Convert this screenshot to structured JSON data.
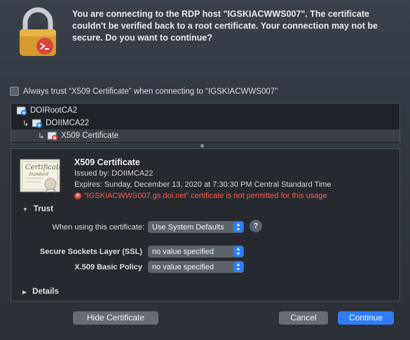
{
  "message": "You are connecting to the RDP host \"IGSKIACWWS007\". The certificate couldn't be verified back to a root certificate. Your connection may not be secure. Do you want to continue?",
  "always_trust": {
    "label": "Always trust “X509 Certificate” when connecting to “IGSKIACWWS007”",
    "checked": false
  },
  "tree": [
    {
      "label": "DOIRootCA2",
      "indent": 0,
      "icon": "certificate-icon"
    },
    {
      "label": "DOIIMCA22",
      "indent": 1,
      "icon": "certificate-icon"
    },
    {
      "label": "X509 Certificate",
      "indent": 2,
      "icon": "certificate-invalid-icon",
      "selected": true
    }
  ],
  "certificate": {
    "title": "X509 Certificate",
    "issued_by": "Issued by: DOIIMCA22",
    "expires": "Expires: Sunday, December 13, 2020 at 7:30:30 PM Central Standard Time",
    "warning": "“IGSKIACWWS007.gs.doi.net” certificate is not permitted for this usage",
    "badge_text_1": "Certificate",
    "badge_text_2": "Standard"
  },
  "trust": {
    "header": "Trust",
    "when_using_label": "When using this certificate:",
    "when_using_value": "Use System Defaults",
    "ssl_label": "Secure Sockets Layer (SSL)",
    "ssl_value": "no value specified",
    "x509_label": "X.509 Basic Policy",
    "x509_value": "no value specified",
    "help": "?"
  },
  "details_header": "Details",
  "buttons": {
    "hide": "Hide Certificate",
    "cancel": "Cancel",
    "continue": "Continue"
  },
  "colors": {
    "accent": "#2f7cf6",
    "warning": "#ff5a52"
  }
}
